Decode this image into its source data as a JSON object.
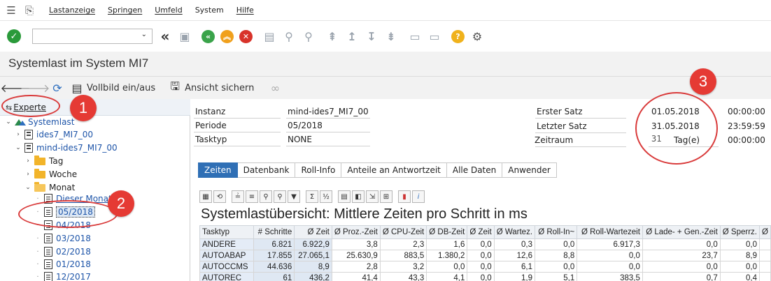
{
  "menu": {
    "items": [
      "Lastanzeige",
      "Springen",
      "Umfeld",
      "System",
      "Hilfe"
    ]
  },
  "toolbar": {
    "command_value": ""
  },
  "title": "Systemlast im System MI7",
  "app_toolbar": {
    "fullscreen_label": "Vollbild ein/aus",
    "save_view_label": "Ansicht sichern"
  },
  "tree": {
    "expert_label": "Experte",
    "nodes": [
      "Systemlast",
      "ides7_MI7_00",
      "mind-ides7_MI7_00",
      "Tag",
      "Woche",
      "Monat",
      "Dieser Monat",
      "05/2018",
      "04/2018",
      "03/2018",
      "02/2018",
      "01/2018",
      "12/2017"
    ]
  },
  "info": {
    "instanz_label": "Instanz",
    "instanz_value": "mind-ides7_MI7_00",
    "periode_label": "Periode",
    "periode_value": "05/2018",
    "tasktyp_label": "Tasktyp",
    "tasktyp_value": "NONE",
    "erster_label": "Erster Satz",
    "erster_date": "01.05.2018",
    "erster_time": "00:00:00",
    "letzter_label": "Letzter Satz",
    "letzter_date": "31.05.2018",
    "letzter_time": "23:59:59",
    "zeitraum_label": "Zeitraum",
    "zeitraum_value": "31",
    "zeitraum_unit": "Tag(e)",
    "zeitraum_time": "00:00:00"
  },
  "tabs": [
    "Zeiten",
    "Datenbank",
    "Roll-Info",
    "Anteile an Antwortzeit",
    "Alle Daten",
    "Anwender"
  ],
  "grid": {
    "title": "Systemlastübersicht: Mittlere Zeiten pro Schritt in ms",
    "columns": [
      "Tasktyp",
      "# Schritte",
      "Ø Zeit",
      "Ø Proz.-Zeit",
      "Ø CPU-Zeit",
      "Ø DB-Zeit",
      "Ø Zeit",
      "Ø Wartez.",
      "Ø Roll-In~",
      "Ø Roll-Wartezeit",
      "Ø Lade- + Gen.-Zeit",
      "Ø Sperrz.",
      "Ø"
    ],
    "rows": [
      [
        "ANDERE",
        "6.821",
        "6.922,9",
        "3,8",
        "2,3",
        "1,6",
        "0,0",
        "0,3",
        "0,0",
        "6.917,3",
        "0,0",
        "0,0",
        ""
      ],
      [
        "AUTOABAP",
        "17.855",
        "27.065,1",
        "25.630,9",
        "883,5",
        "1.380,2",
        "0,0",
        "12,6",
        "8,8",
        "0,0",
        "23,7",
        "8,9",
        ""
      ],
      [
        "AUTOCCMS",
        "44.636",
        "8,9",
        "2,8",
        "3,2",
        "0,0",
        "0,0",
        "6,1",
        "0,0",
        "0,0",
        "0,0",
        "0,0",
        ""
      ],
      [
        "AUTOREC",
        "61",
        "436,2",
        "41,4",
        "43,3",
        "4,1",
        "0,0",
        "1,9",
        "5,1",
        "383,5",
        "0,7",
        "0,4",
        ""
      ]
    ]
  },
  "annotations": [
    "1",
    "2",
    "3"
  ]
}
